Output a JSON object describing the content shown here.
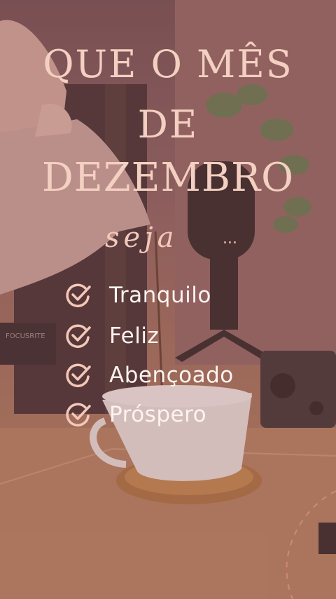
{
  "headline": {
    "line1": "QUE O MÊS",
    "line2": "DE",
    "line3": "DEZEMBRO"
  },
  "subtitle": {
    "text": "seja",
    "ellipsis": "..."
  },
  "wishes": [
    {
      "label": "Tranquilo",
      "icon": "check-circle-icon"
    },
    {
      "label": "Feliz",
      "icon": "check-circle-icon"
    },
    {
      "label": "Abençoado",
      "icon": "check-circle-icon"
    },
    {
      "label": "Próspero",
      "icon": "check-circle-icon"
    }
  ],
  "photo": {
    "device_label": "FOCUSRITE"
  },
  "colors": {
    "headline": "#f3d0c1",
    "list_text": "#fbf3ef",
    "check": "#f4c8b8",
    "overlay": "#a06a6a"
  }
}
